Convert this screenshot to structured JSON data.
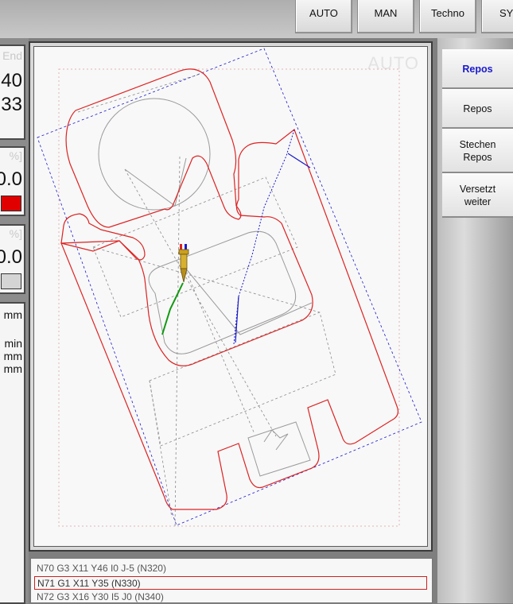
{
  "top_bar": {
    "buttons": [
      "AUTO",
      "MAN",
      "Techno",
      "SY"
    ]
  },
  "left_panels": {
    "panel1": {
      "header": "End",
      "value1": "40",
      "value2": "33"
    },
    "panel2": {
      "header": "%]",
      "value": "0.0",
      "indicator_color": "#e00000"
    },
    "panel3": {
      "header": "%]",
      "value": "0.0",
      "indicator_color": "#d4d4d4"
    },
    "panel4": {
      "unit1": "mm",
      "unit2": "min",
      "unit3": "mm",
      "unit4": "mm"
    }
  },
  "viewport": {
    "mode_watermark": "AUTO"
  },
  "side_menu": {
    "items": [
      {
        "label": "Repos",
        "active": true
      },
      {
        "label": "Repos",
        "active": false
      },
      {
        "label_line1": "Stechen",
        "label_line2": "Repos",
        "active": false
      },
      {
        "label_line1": "Versetzt",
        "label_line2": "weiter",
        "active": false
      }
    ]
  },
  "nc_program": {
    "lines": [
      "N70 G3 X11 Y46 I0 J-5 (N320)",
      "N71 G1 X11 Y35 (N330)",
      "N72 G3 X16 Y30 I5 J0 (N340)"
    ],
    "current_index": 1
  },
  "colors": {
    "cut_contour": "#dd2222",
    "traverse_dashed": "#888888",
    "sheet_outline": "#1a1acc",
    "tool_path": "#1a1acc",
    "green_path": "#119911",
    "tool": "#c8a020"
  }
}
